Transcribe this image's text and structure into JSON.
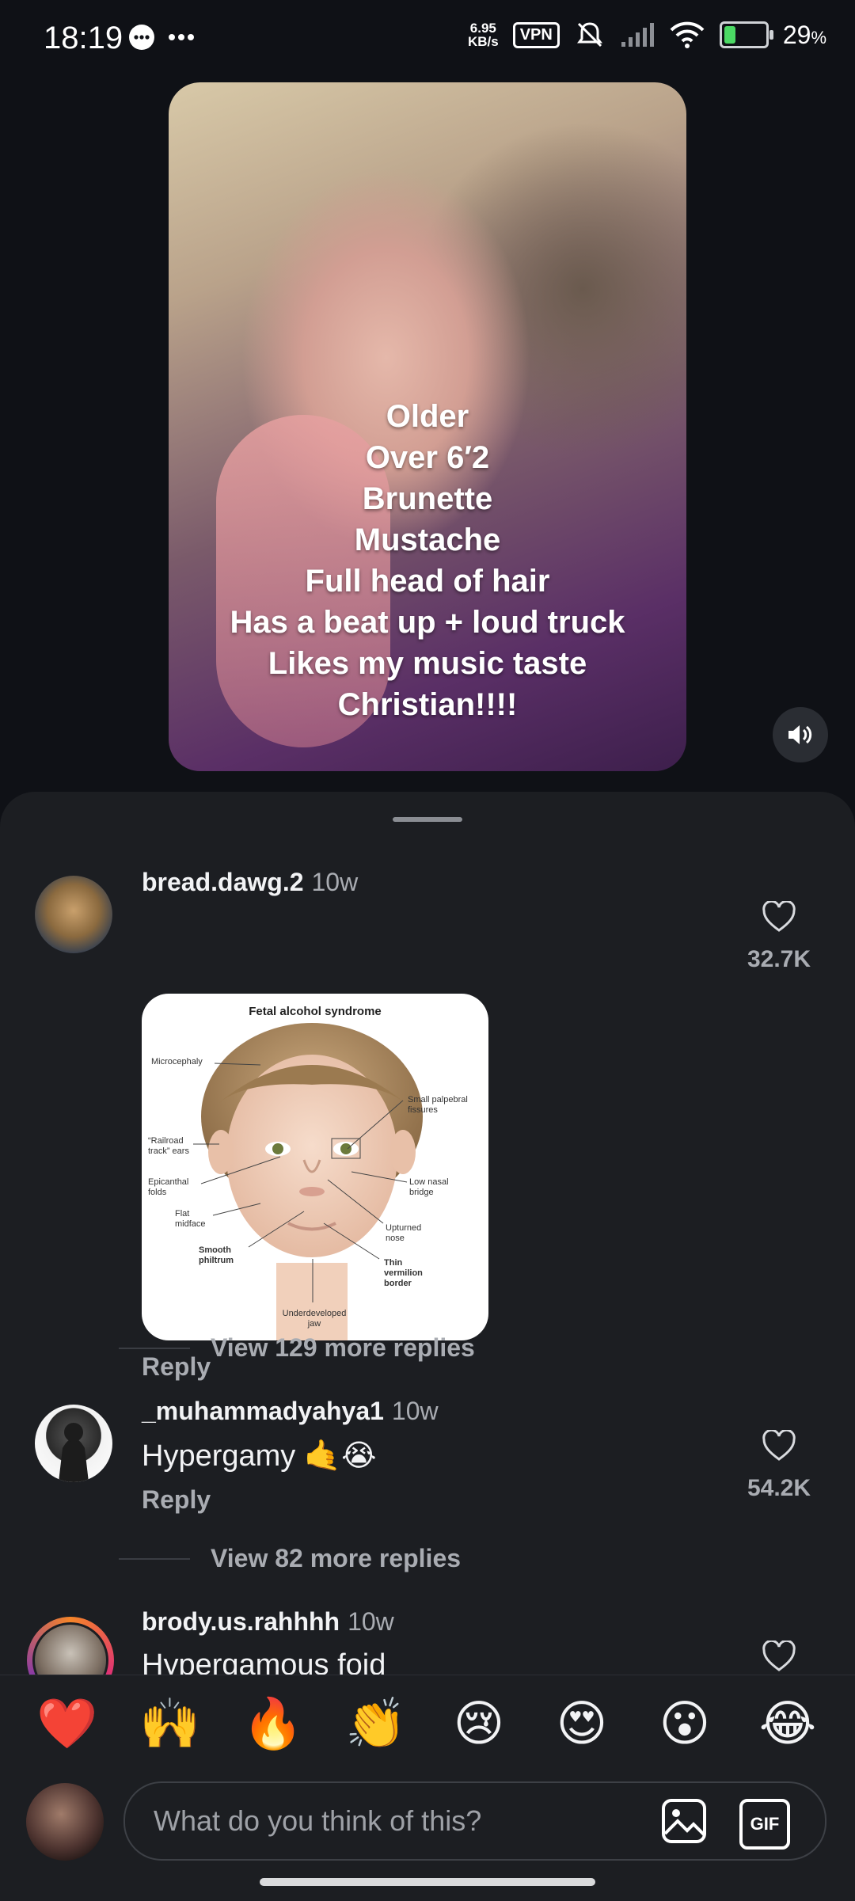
{
  "status": {
    "time": "18:19",
    "speed_value": "6.95",
    "speed_unit": "KB/s",
    "vpn": "VPN",
    "battery": "29",
    "battery_unit": "%",
    "battery_level": 0.29
  },
  "video": {
    "overlay_lines": [
      "Older",
      "Over 6′2",
      "Brunette",
      "Mustache",
      "Full head of hair",
      "Has a beat up + loud truck",
      "Likes my music taste",
      "Christian!!!!"
    ]
  },
  "comments": [
    {
      "username": "bread.dawg.2",
      "time": "10w",
      "likes": "32.7K",
      "reply": "Reply",
      "view_more": "View 129 more replies",
      "image": {
        "title": "Fetal alcohol syndrome",
        "labels": {
          "microcephaly": "Microcephaly",
          "small_palpebral": "Small palpebral fissures",
          "railroad": "“Railroad track” ears",
          "epicanthal": "Epicanthal folds",
          "low_nasal": "Low nasal bridge",
          "flat_midface": "Flat midface",
          "upturned": "Upturned nose",
          "smooth_philtrum": "Smooth philtrum",
          "thin_vermilion": "Thin vermilion border",
          "underdeveloped": "Underdeveloped jaw"
        }
      }
    },
    {
      "username": "_muhammadyahya1",
      "time": "10w",
      "text": "Hypergamy 🤙😭",
      "likes": "54.2K",
      "reply": "Reply",
      "view_more": "View 82 more replies"
    },
    {
      "username": "brody.us.rahhhh",
      "time": "10w",
      "text": "Hypergamous foid"
    }
  ],
  "emoji_bar": [
    "❤️",
    "🙌",
    "🔥",
    "👏",
    "😢",
    "😍",
    "😮",
    "😂"
  ],
  "input": {
    "placeholder": "What do you think of this?",
    "gif_label": "GIF"
  }
}
